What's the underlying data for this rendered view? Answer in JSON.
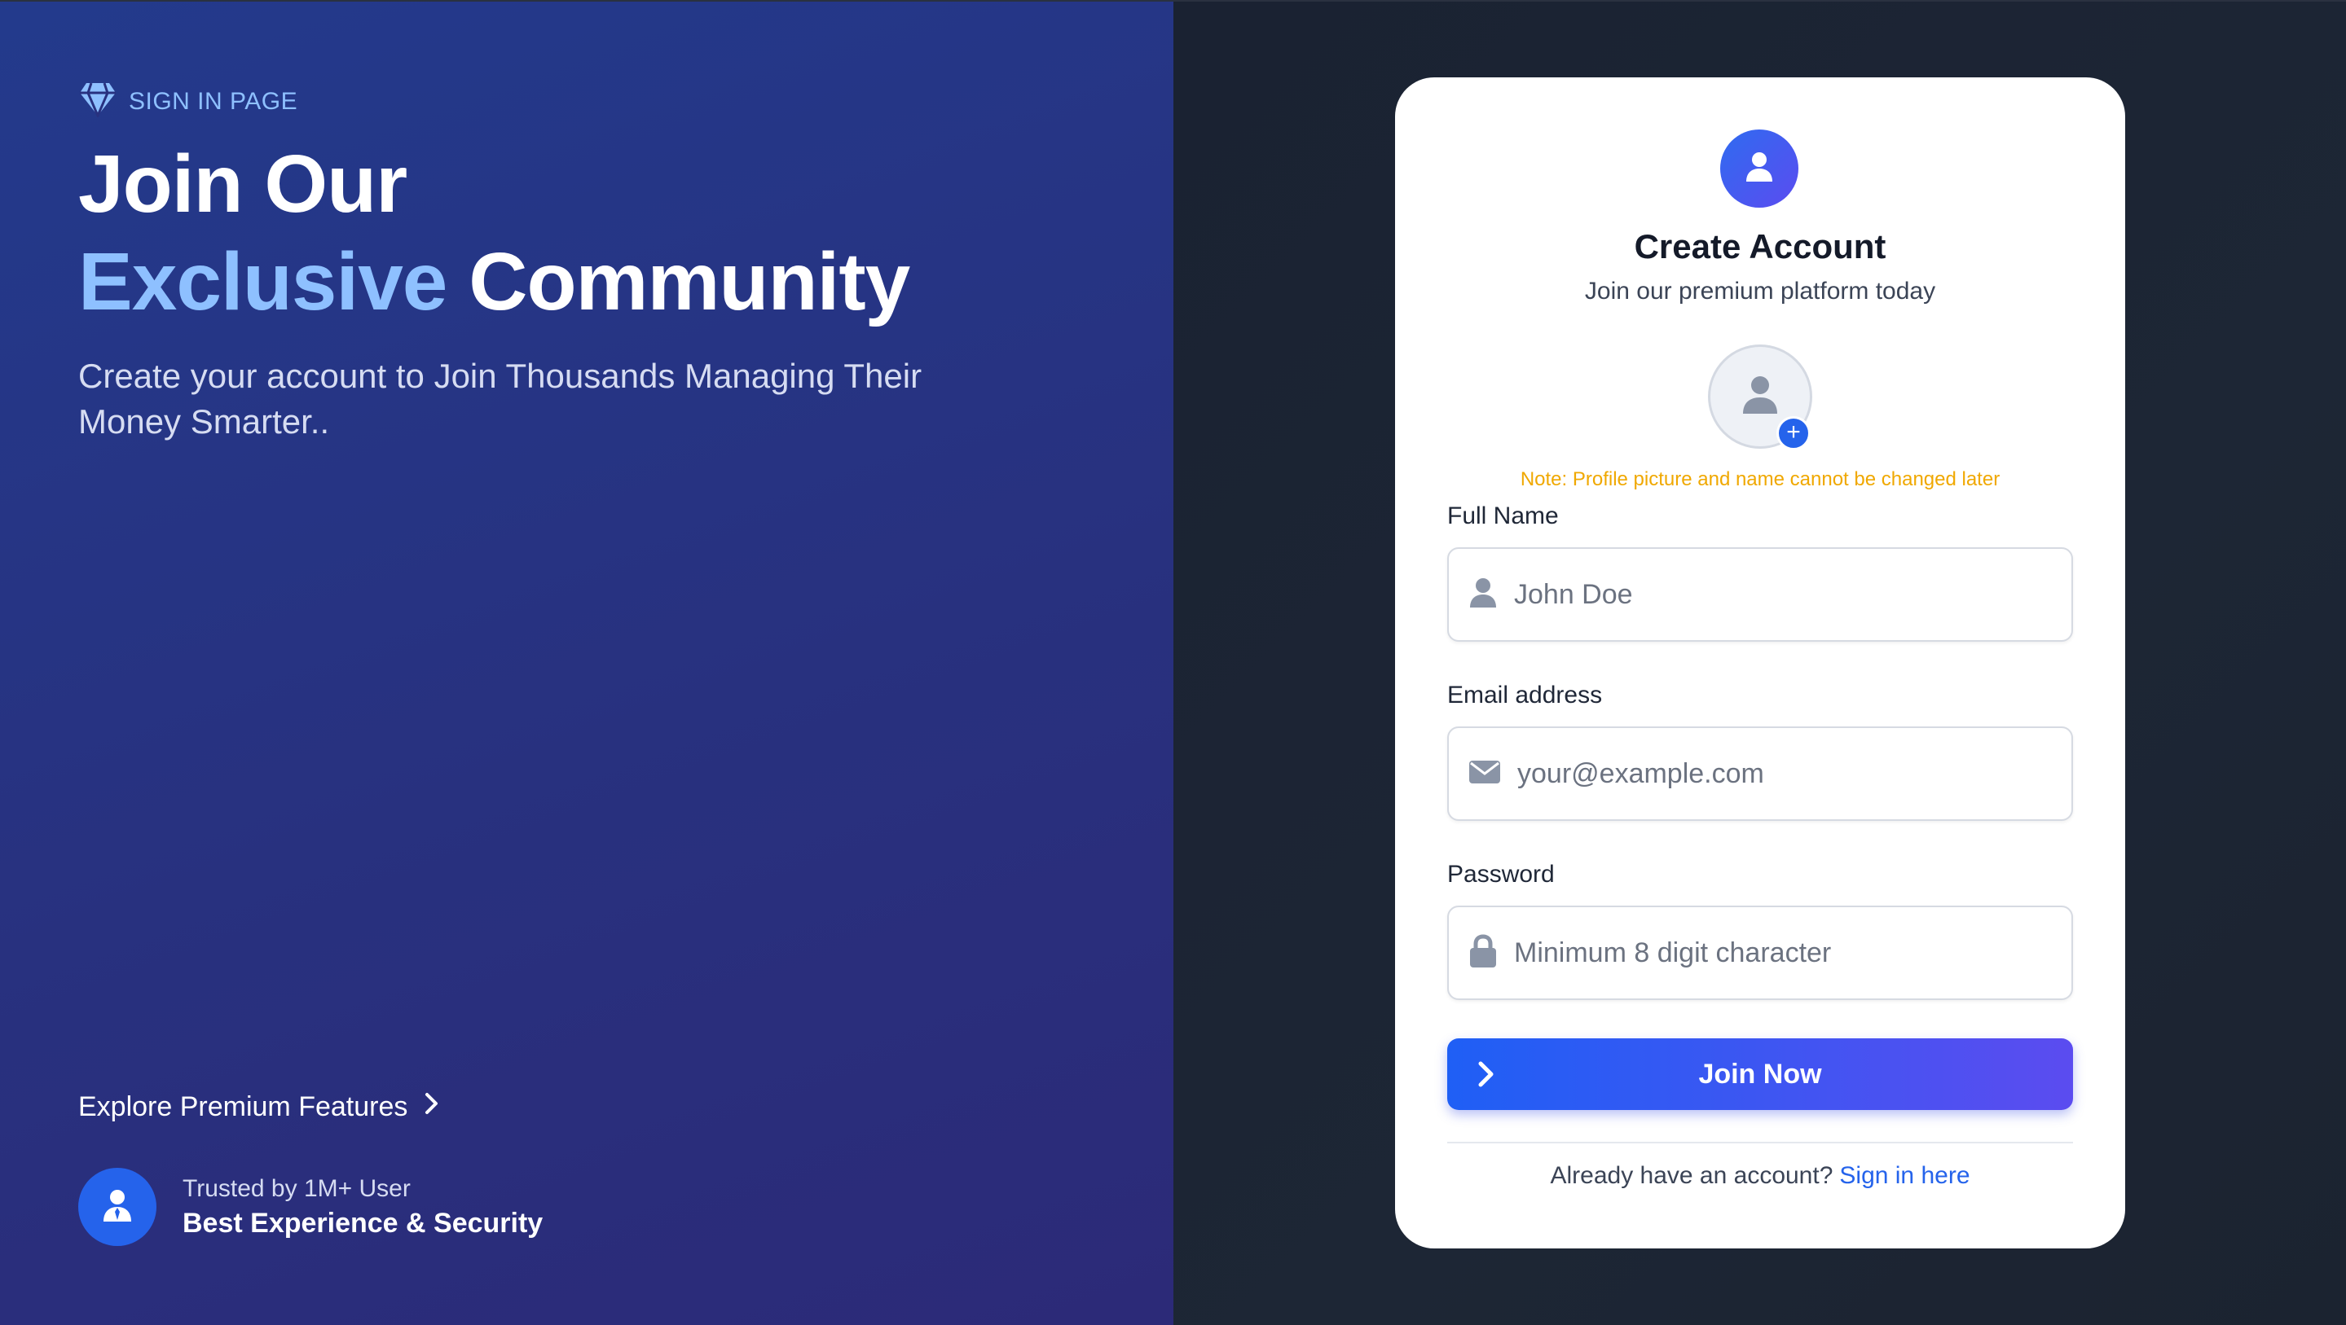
{
  "hero": {
    "tag": "SIGN IN PAGE",
    "title_line1": "Join Our",
    "title_accent": "Exclusive",
    "title_rest": "Community",
    "subtitle": "Create your account to Join Thousands Managing Their Money Smarter..",
    "explore_label": "Explore Premium Features",
    "trust_line1": "Trusted by 1M+ User",
    "trust_line2": "Best Experience & Security",
    "accent_color": "#8ec0ff"
  },
  "card": {
    "title": "Create Account",
    "subtitle": "Join our premium platform today",
    "photo_add_symbol": "+",
    "note": "Note: Profile picture and name cannot be changed later",
    "note_color": "#f0a800",
    "fields": {
      "name": {
        "label": "Full Name",
        "placeholder": "John Doe",
        "icon": "user-icon"
      },
      "email": {
        "label": "Email address",
        "placeholder": "your@example.com",
        "icon": "envelope-icon"
      },
      "password": {
        "label": "Password",
        "placeholder": "Minimum 8 digit character",
        "icon": "lock-icon"
      }
    },
    "submit_label": "Join Now",
    "signin_prompt": "Already have an account?",
    "signin_link": "Sign in here",
    "link_color": "#2563eb"
  }
}
